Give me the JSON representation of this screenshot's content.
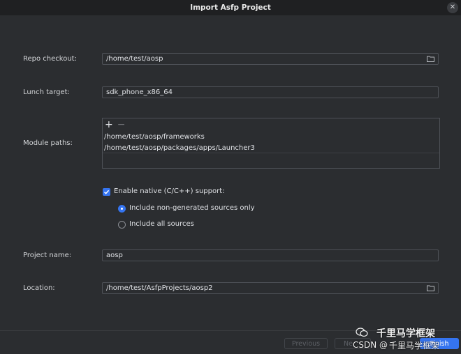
{
  "window": {
    "title": "Import Asfp Project",
    "close_glyph": "✕"
  },
  "repo_checkout": {
    "label": "Repo checkout:",
    "value": "/home/test/aosp",
    "icon": "folder-icon"
  },
  "lunch_target": {
    "label": "Lunch target:",
    "value": "sdk_phone_x86_64"
  },
  "module_paths": {
    "label": "Module paths:",
    "add_glyph": "+",
    "remove_glyph": "−",
    "items": [
      "/home/test/aosp/frameworks",
      "/home/test/aosp/packages/apps/Launcher3"
    ]
  },
  "native_support": {
    "label": "Enable native (C/C++) support:",
    "checked": true,
    "options": [
      {
        "label": "Include non-generated sources only",
        "selected": true
      },
      {
        "label": "Include all sources",
        "selected": false
      }
    ]
  },
  "project_name": {
    "label": "Project name:",
    "value": "aosp"
  },
  "location": {
    "label": "Location:",
    "value": "/home/test/AsfpProjects/aosp2",
    "icon": "folder-icon"
  },
  "buttons": {
    "previous": "Previous",
    "next": "Ne",
    "finish": "Finish"
  },
  "watermark": {
    "brand": "千里马学框架",
    "csdn": "CSDN @",
    "csdn_tail": "千里马学框架",
    "icon": "wechat-icon"
  },
  "colors": {
    "accent": "#3574f0",
    "background": "#2b2d30",
    "titlebar": "#1f2022"
  }
}
